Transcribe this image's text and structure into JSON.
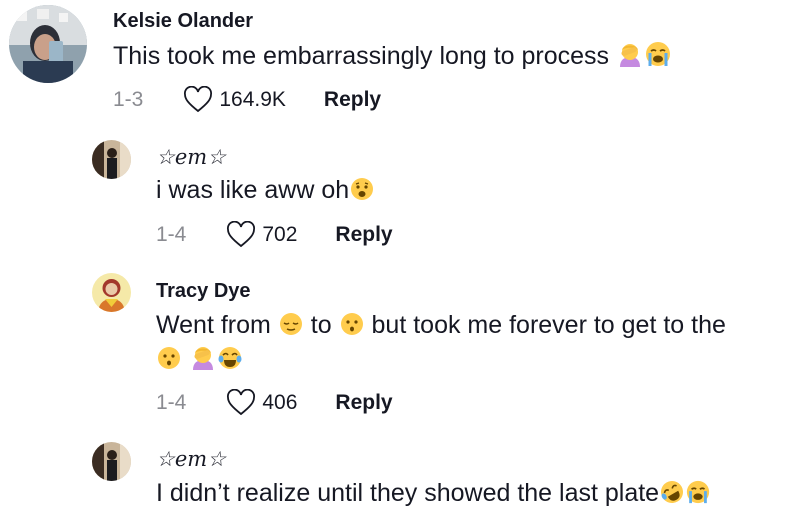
{
  "comments": [
    {
      "username": "Kelsie Olander",
      "text": "This took me embarrassingly long to process",
      "emojis": [
        "person-facepalming-emoji",
        "loudly-crying-emoji"
      ],
      "date": "1-3",
      "likes": "164.9K",
      "reply_label": "Reply"
    },
    {
      "username": "☆em☆",
      "text": "i was like aww oh",
      "emojis": [
        "anguished-face-emoji"
      ],
      "date": "1-4",
      "likes": "702",
      "reply_label": "Reply"
    },
    {
      "username": "Tracy Dye",
      "text_part1": "Went from",
      "text_part2": "to",
      "text_part3": "but took me forever to get to the",
      "emojis": [
        "relieved-face-emoji",
        "hushed-face-emoji",
        "hushed-face-emoji",
        "person-facepalming-emoji",
        "tears-of-joy-emoji"
      ],
      "date": "1-4",
      "likes": "406",
      "reply_label": "Reply"
    },
    {
      "username": "☆em☆",
      "text": "I didn’t realize until they showed the last plate",
      "emojis": [
        "rolling-laughing-emoji",
        "loudly-crying-emoji"
      ]
    }
  ],
  "colors": {
    "text": "#161823",
    "meta": "#8a8b91",
    "emoji_yellow": "#ffcc4d"
  }
}
